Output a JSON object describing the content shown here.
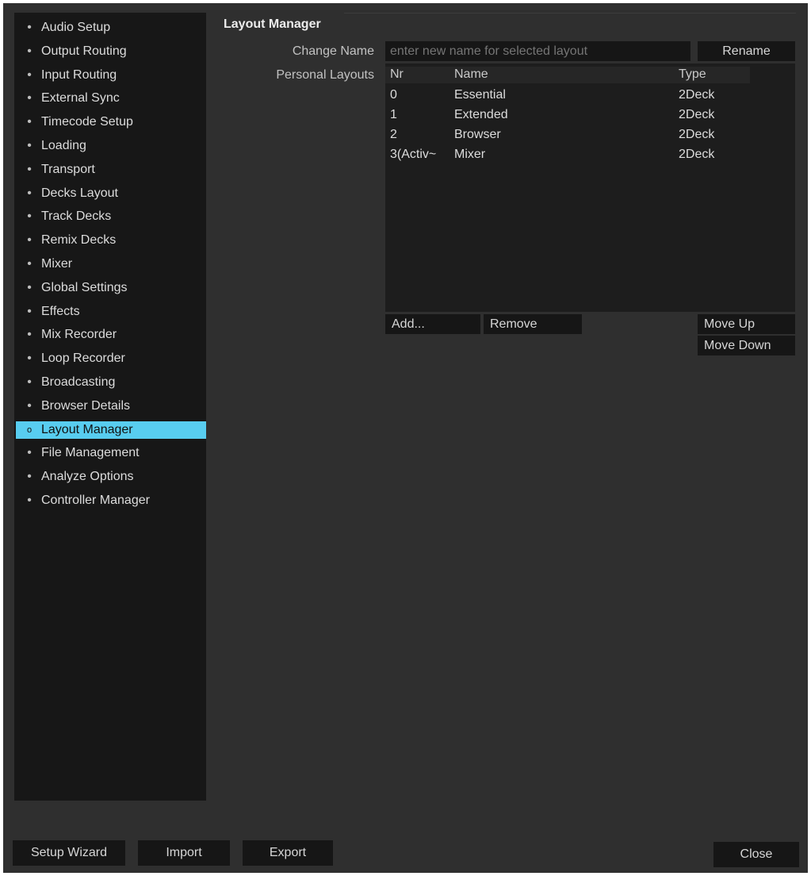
{
  "sidebar": {
    "items": [
      {
        "label": "Audio Setup",
        "bullet": "•"
      },
      {
        "label": "Output Routing",
        "bullet": "•"
      },
      {
        "label": "Input Routing",
        "bullet": "•"
      },
      {
        "label": "External Sync",
        "bullet": "•"
      },
      {
        "label": "Timecode Setup",
        "bullet": "•"
      },
      {
        "label": "Loading",
        "bullet": "•"
      },
      {
        "label": "Transport",
        "bullet": "•"
      },
      {
        "label": "Decks Layout",
        "bullet": "•"
      },
      {
        "label": "Track Decks",
        "bullet": "•"
      },
      {
        "label": "Remix Decks",
        "bullet": "•"
      },
      {
        "label": "Mixer",
        "bullet": "•"
      },
      {
        "label": "Global Settings",
        "bullet": "•"
      },
      {
        "label": "Effects",
        "bullet": "•"
      },
      {
        "label": "Mix Recorder",
        "bullet": "•"
      },
      {
        "label": "Loop Recorder",
        "bullet": "•"
      },
      {
        "label": "Broadcasting",
        "bullet": "•"
      },
      {
        "label": "Browser Details",
        "bullet": "•"
      },
      {
        "label": "Layout Manager",
        "bullet": "o",
        "active": true
      },
      {
        "label": "File Management",
        "bullet": "•"
      },
      {
        "label": "Analyze Options",
        "bullet": "•"
      },
      {
        "label": "Controller Manager",
        "bullet": "•"
      }
    ]
  },
  "main": {
    "title": "Layout Manager",
    "change_name": {
      "label": "Change Name",
      "placeholder": "enter new name for selected layout",
      "rename_button": "Rename"
    },
    "personal_layouts": {
      "label": "Personal Layouts",
      "columns": [
        "Nr",
        "Name",
        "Type"
      ],
      "rows": [
        {
          "nr": "0",
          "name": "Essential",
          "type": "2Deck"
        },
        {
          "nr": "1",
          "name": "Extended",
          "type": "2Deck"
        },
        {
          "nr": "2",
          "name": "Browser",
          "type": "2Deck"
        },
        {
          "nr": "3(Activ~",
          "name": "Mixer",
          "type": "2Deck"
        }
      ],
      "add_button": "Add...",
      "remove_button": "Remove",
      "move_up_button": "Move Up",
      "move_down_button": "Move Down"
    }
  },
  "footer": {
    "setup_wizard": "Setup Wizard",
    "import": "Import",
    "export": "Export",
    "close": "Close"
  },
  "colors": {
    "accent": "#58cdf0",
    "window_bg": "#2f2f2f",
    "sidebar_bg": "#171717"
  }
}
